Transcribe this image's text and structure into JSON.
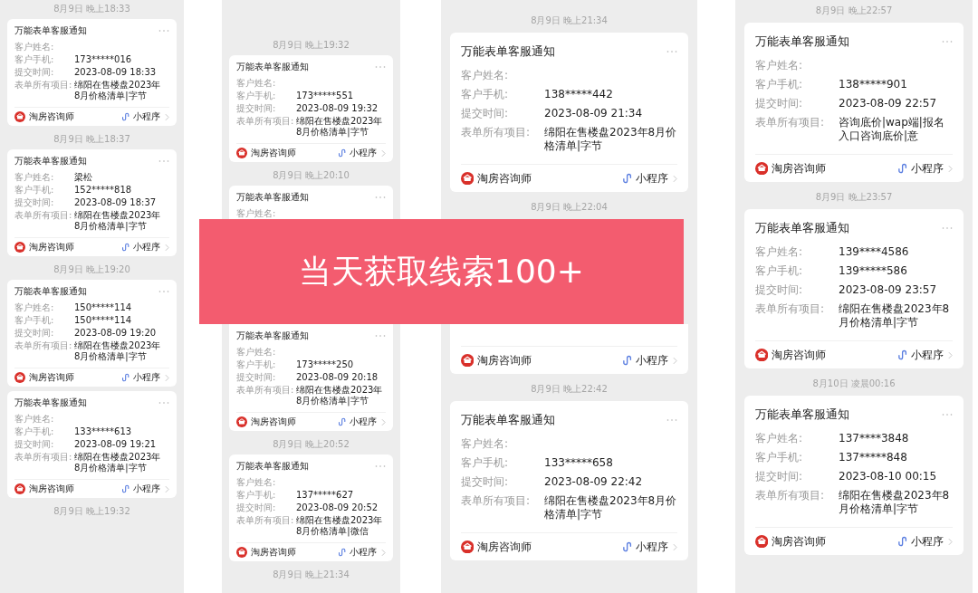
{
  "columns": [
    {
      "items": [
        {
          "kind": "time",
          "text": "8月9日 晚上18:33"
        },
        {
          "kind": "card",
          "title": "万能表单客服通知",
          "rows": [
            {
              "label": "客户姓名:"
            },
            {
              "label": "客户手机:",
              "value": "173*****016"
            },
            {
              "label": "提交时间:",
              "value": "2023-08-09 18:33"
            },
            {
              "label": "表单所有项目:",
              "value": "绵阳在售楼盘2023年8月价格清单|字节"
            }
          ],
          "footer": {
            "source": "淘房咨询师",
            "link": "小程序"
          }
        },
        {
          "kind": "time",
          "text": "8月9日 晚上18:37"
        },
        {
          "kind": "card",
          "title": "万能表单客服通知",
          "rows": [
            {
              "label": "客户姓名:",
              "value": "梁松"
            },
            {
              "label": "客户手机:",
              "value": "152*****818"
            },
            {
              "label": "提交时间:",
              "value": "2023-08-09 18:37"
            },
            {
              "label": "表单所有项目:",
              "value": "绵阳在售楼盘2023年8月价格清单|字节"
            }
          ],
          "footer": {
            "source": "淘房咨询师",
            "link": "小程序"
          }
        },
        {
          "kind": "time",
          "text": "8月9日 晚上19:20"
        },
        {
          "kind": "card",
          "title": "万能表单客服通知",
          "rows": [
            {
              "label": "客户姓名:",
              "value": "150*****114"
            },
            {
              "label": "客户手机:",
              "value": "150*****114"
            },
            {
              "label": "提交时间:",
              "value": "2023-08-09 19:20"
            },
            {
              "label": "表单所有项目:",
              "value": "绵阳在售楼盘2023年8月价格清单|字节"
            }
          ],
          "footer": {
            "source": "淘房咨询师",
            "link": "小程序"
          }
        },
        {
          "kind": "card",
          "title": "万能表单客服通知",
          "rows": [
            {
              "label": "客户姓名:"
            },
            {
              "label": "客户手机:",
              "value": "133*****613"
            },
            {
              "label": "提交时间:",
              "value": "2023-08-09 19:21"
            },
            {
              "label": "表单所有项目:",
              "value": "绵阳在售楼盘2023年8月价格清单|字节"
            }
          ],
          "footer": {
            "source": "淘房咨询师",
            "link": "小程序"
          }
        },
        {
          "kind": "time",
          "text": "8月9日 晚上19:32"
        }
      ]
    },
    {
      "items": [
        {
          "kind": "time",
          "text": "8月9日 晚上19:32"
        },
        {
          "kind": "card",
          "title": "万能表单客服通知",
          "rows": [
            {
              "label": "客户姓名:"
            },
            {
              "label": "客户手机:",
              "value": "173*****551"
            },
            {
              "label": "提交时间:",
              "value": "2023-08-09 19:32"
            },
            {
              "label": "表单所有项目:",
              "value": "绵阳在售楼盘2023年8月价格清单|字节"
            }
          ],
          "footer": {
            "source": "淘房咨询师",
            "link": "小程序"
          }
        },
        {
          "kind": "time",
          "text": "8月9日 晚上20:10"
        },
        {
          "kind": "card",
          "bottom_covered": true,
          "title": "万能表单客服通知",
          "rows": [
            {
              "label": "客户姓名:"
            }
          ]
        },
        {
          "kind": "covered"
        },
        {
          "kind": "card",
          "top_covered": true,
          "title": "万能表单客服通知",
          "rows": [
            {
              "label": "客户姓名:"
            },
            {
              "label": "客户手机:",
              "value": "173*****250"
            },
            {
              "label": "提交时间:",
              "value": "2023-08-09 20:18"
            },
            {
              "label": "表单所有项目:",
              "value": "绵阳在售楼盘2023年8月价格清单|字节"
            }
          ],
          "footer": {
            "source": "淘房咨询师",
            "link": "小程序"
          }
        },
        {
          "kind": "time",
          "text": "8月9日 晚上20:52"
        },
        {
          "kind": "card",
          "title": "万能表单客服通知",
          "rows": [
            {
              "label": "客户姓名:"
            },
            {
              "label": "客户手机:",
              "value": "137*****627"
            },
            {
              "label": "提交时间:",
              "value": "2023-08-09 20:52"
            },
            {
              "label": "表单所有项目:",
              "value": "绵阳在售楼盘2023年8月价格清单|微信"
            }
          ],
          "footer": {
            "source": "淘房咨询师",
            "link": "小程序"
          }
        },
        {
          "kind": "time",
          "text": "8月9日 晚上21:34"
        }
      ]
    },
    {
      "items": [
        {
          "kind": "time",
          "text": "8月9日 晚上21:34"
        },
        {
          "kind": "card",
          "title": "万能表单客服通知",
          "rows": [
            {
              "label": "客户姓名:"
            },
            {
              "label": "客户手机:",
              "value": "138*****442"
            },
            {
              "label": "提交时间:",
              "value": "2023-08-09 21:34"
            },
            {
              "label": "表单所有项目:",
              "value": "绵阳在售楼盘2023年8月价格清单|字节"
            }
          ],
          "footer": {
            "source": "淘房咨询师",
            "link": "小程序"
          }
        },
        {
          "kind": "time",
          "text": "8月9日 晚上22:04"
        },
        {
          "kind": "covered"
        },
        {
          "kind": "card",
          "top_covered": true,
          "footer": {
            "source": "淘房咨询师",
            "link": "小程序"
          }
        },
        {
          "kind": "time",
          "text": "8月9日 晚上22:42"
        },
        {
          "kind": "card",
          "title": "万能表单客服通知",
          "rows": [
            {
              "label": "客户姓名:"
            },
            {
              "label": "客户手机:",
              "value": "133*****658"
            },
            {
              "label": "提交时间:",
              "value": "2023-08-09 22:42"
            },
            {
              "label": "表单所有项目:",
              "value": "绵阳在售楼盘2023年8月价格清单|字节"
            }
          ],
          "footer": {
            "source": "淘房咨询师",
            "link": "小程序"
          }
        }
      ]
    },
    {
      "items": [
        {
          "kind": "time",
          "text": "8月9日 晚上22:57"
        },
        {
          "kind": "card",
          "title": "万能表单客服通知",
          "rows": [
            {
              "label": "客户姓名:"
            },
            {
              "label": "客户手机:",
              "value": "138*****901"
            },
            {
              "label": "提交时间:",
              "value": "2023-08-09 22:57"
            },
            {
              "label": "表单所有项目:",
              "value": "咨询底价|wap端|报名入口咨询底价|意"
            }
          ],
          "footer": {
            "source": "淘房咨询师",
            "link": "小程序"
          }
        },
        {
          "kind": "time",
          "text": "8月9日 晚上23:57"
        },
        {
          "kind": "card",
          "title": "万能表单客服通知",
          "rows": [
            {
              "label": "客户姓名:",
              "value": "139****4586"
            },
            {
              "label": "客户手机:",
              "value": "139*****586"
            },
            {
              "label": "提交时间:",
              "value": "2023-08-09 23:57"
            },
            {
              "label": "表单所有项目:",
              "value": "绵阳在售楼盘2023年8月价格清单|字节"
            }
          ],
          "footer": {
            "source": "淘房咨询师",
            "link": "小程序"
          }
        },
        {
          "kind": "time",
          "text": "8月10日 凌晨00:16"
        },
        {
          "kind": "card",
          "title": "万能表单客服通知",
          "rows": [
            {
              "label": "客户姓名:",
              "value": "137****3848"
            },
            {
              "label": "客户手机:",
              "value": "137*****848"
            },
            {
              "label": "提交时间:",
              "value": "2023-08-10 00:15"
            },
            {
              "label": "表单所有项目:",
              "value": "绵阳在售楼盘2023年8月价格清单|字节"
            }
          ],
          "footer": {
            "source": "淘房咨询师",
            "link": "小程序"
          }
        }
      ]
    }
  ],
  "banner": {
    "text": "当天获取线索100+"
  }
}
